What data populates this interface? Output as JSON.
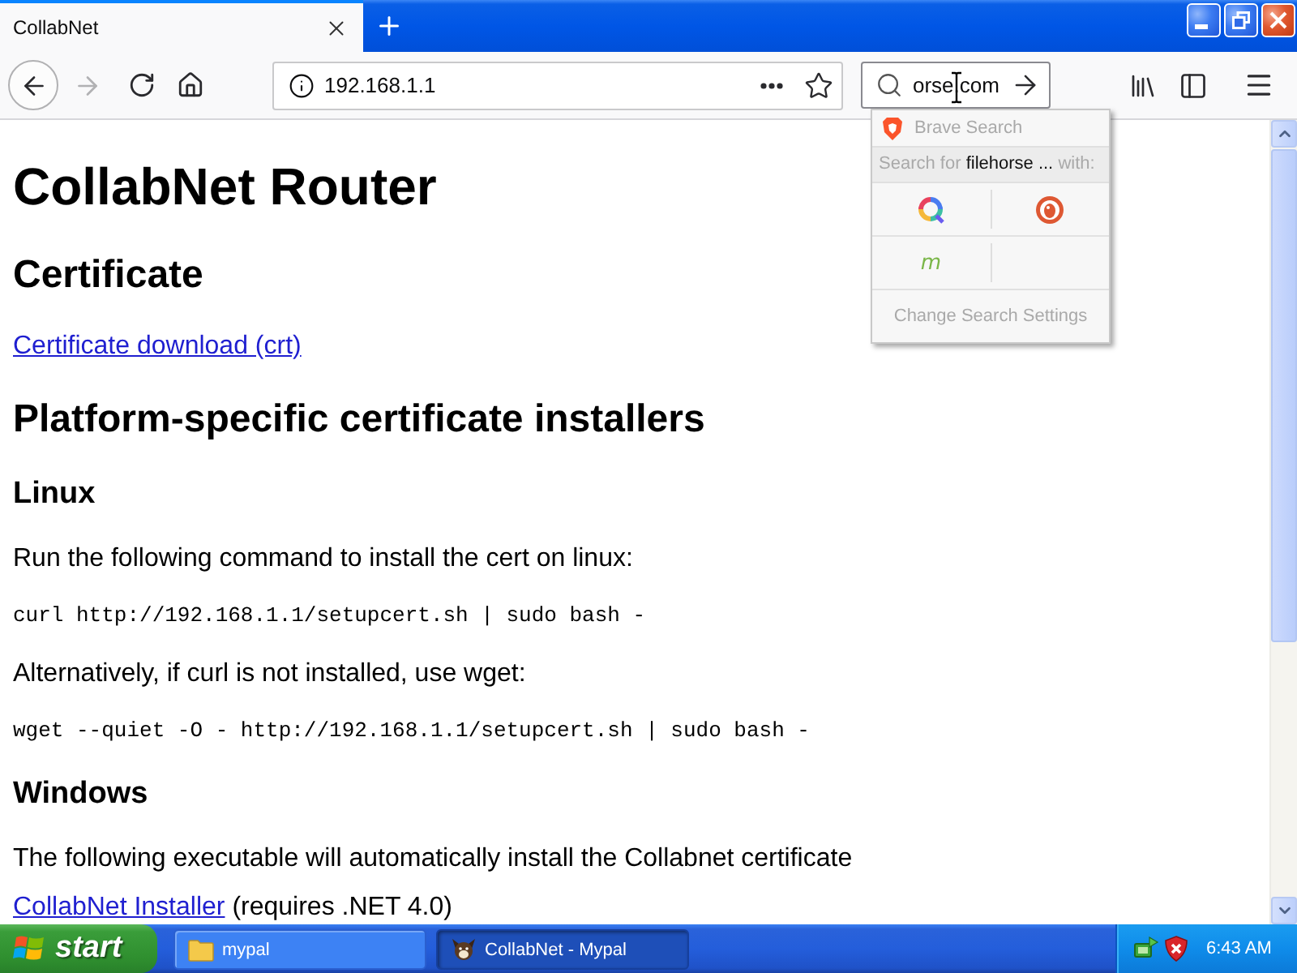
{
  "tabs": [
    {
      "title": "CollabNet",
      "selected": true
    }
  ],
  "toolbar": {
    "forward_disabled": true,
    "url": "192.168.1.1",
    "search_value": "orse.com"
  },
  "search_popup": {
    "engine": "Brave Search",
    "prompt": {
      "before": "Search for",
      "term": "filehorse ...",
      "after": "with:"
    },
    "engines": [
      {
        "kind": "ring"
      },
      {
        "kind": "disc"
      },
      {
        "kind": "letter",
        "glyph": "m"
      }
    ],
    "settings": "Change Search Settings"
  },
  "page": {
    "blocks": [
      {
        "kind": "h1",
        "text": "CollabNet Router"
      },
      {
        "kind": "h2",
        "text": "Certificate"
      },
      {
        "kind": "link",
        "text": "Certificate download (crt)"
      },
      {
        "kind": "h2",
        "text": "Platform-specific certificate installers"
      },
      {
        "kind": "h3",
        "text": "Linux"
      },
      {
        "kind": "p",
        "text": "Run the following command to install the cert on linux:"
      },
      {
        "kind": "pre",
        "text": "curl http://192.168.1.1/setupcert.sh | sudo bash -"
      },
      {
        "kind": "p",
        "text": "Alternatively, if curl is not installed, use wget:"
      },
      {
        "kind": "pre",
        "text": "wget --quiet -O - http://192.168.1.1/setupcert.sh | sudo bash -"
      },
      {
        "kind": "h3",
        "text": "Windows"
      },
      {
        "kind": "p",
        "text": "The following executable will automatically install the Collabnet certificate"
      },
      {
        "kind": "link_para",
        "link": "CollabNet Installer",
        "text": "(requires .NET 4.0)"
      }
    ]
  },
  "taskbar": {
    "start": "start",
    "tasks": [
      {
        "label": "mypal",
        "kind": "folder",
        "selected": false
      },
      {
        "label": "CollabNet - Mypal",
        "kind": "app",
        "selected": true
      }
    ],
    "clock": "6:43 AM"
  }
}
